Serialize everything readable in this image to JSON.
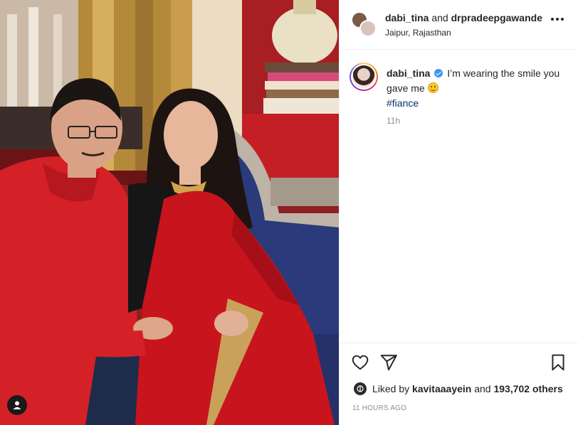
{
  "post": {
    "header": {
      "author": "dabi_tina",
      "conjunction": "and",
      "collaborator": "drpradeepgawande",
      "location": "Jaipur, Rajasthan",
      "more_icon": "more-horizontal-icon"
    },
    "caption": {
      "username": "dabi_tina",
      "verified": true,
      "text": "I’m wearing the smile you gave me",
      "emoji": "slightly-smiling-face",
      "hashtag": "#fiance",
      "relative_time": "11h"
    },
    "actions": {
      "like_icon": "heart-icon",
      "share_icon": "paper-plane-icon",
      "save_icon": "bookmark-icon"
    },
    "likes": {
      "prefix": "Liked by",
      "liker": "kavitaaayein",
      "and": "and",
      "others": "193,702 others"
    },
    "timestamp": "11 HOURS AGO"
  },
  "colors": {
    "text": "#262626",
    "muted": "#8e8e8e",
    "hashtag": "#00376b",
    "verified": "#3897f0",
    "border": "#efefef"
  }
}
